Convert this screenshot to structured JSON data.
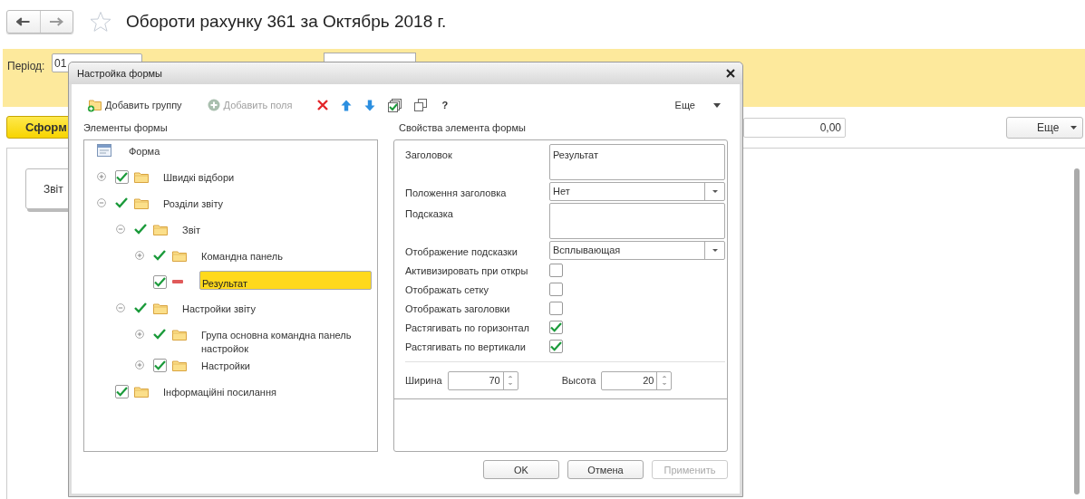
{
  "header": {
    "title": "Обороти рахунку 361 за Октябрь 2018 г."
  },
  "filter_bar": {
    "period_label": "Період:",
    "period_value": "01"
  },
  "command_bar": {
    "generate_button": "Сформ",
    "total_value": "0,00",
    "more_button": "Еще"
  },
  "report": {
    "tab_label": "Звіт"
  },
  "dialog": {
    "title": "Настройка формы",
    "toolbar": [
      {
        "kind": "add-group",
        "label": "Добавить группу",
        "disabled": false
      },
      {
        "kind": "add-field",
        "label": "Добавить поля",
        "disabled": true
      },
      {
        "kind": "delete",
        "disabled": false
      },
      {
        "kind": "up",
        "disabled": false
      },
      {
        "kind": "down",
        "disabled": false
      },
      {
        "kind": "check-all",
        "disabled": false
      },
      {
        "kind": "copy",
        "disabled": false
      },
      {
        "kind": "help",
        "label": "?",
        "disabled": false
      }
    ],
    "more_button": "Еще",
    "tree_heading": "Элементы формы",
    "properties_heading": "Свойства элемента формы",
    "tree": [
      {
        "label": "Форма",
        "kind": "form",
        "selected": false,
        "children": [
          {
            "label": "Швидкі відбори",
            "kind": "boxed-folder",
            "checked": true,
            "expanded": false,
            "selected": false
          },
          {
            "label": "Розділи звіту",
            "kind": "ticked-folder",
            "checked": true,
            "expanded": true,
            "selected": false,
            "children": [
              {
                "label": "Звіт",
                "kind": "ticked-folder",
                "checked": true,
                "expanded": true,
                "selected": false,
                "children": [
                  {
                    "label": "Командна панель",
                    "kind": "ticked-folder",
                    "checked": true,
                    "expanded": false,
                    "selected": false
                  },
                  {
                    "label": "Результат",
                    "kind": "boxed-field",
                    "checked": true,
                    "selected": true
                  }
                ]
              },
              {
                "label": "Настройки звіту",
                "kind": "ticked-folder",
                "checked": true,
                "expanded": true,
                "selected": false,
                "children": [
                  {
                    "label": "Група основна командна панель настройок",
                    "kind": "ticked-folder",
                    "checked": true,
                    "expanded": false,
                    "selected": false
                  },
                  {
                    "label": "Настройки",
                    "kind": "boxed-folder",
                    "checked": true,
                    "expanded": false,
                    "selected": false
                  }
                ]
              }
            ]
          },
          {
            "label": "Інформаційні посилання",
            "kind": "boxed-folder",
            "checked": true,
            "selected": false
          }
        ]
      }
    ],
    "properties": [
      {
        "kind": "textarea",
        "label": "Заголовок",
        "value": "Результат"
      },
      {
        "kind": "select",
        "label": "Положення заголовка",
        "value": "Нет"
      },
      {
        "kind": "textarea",
        "label": "Подсказка"
      },
      {
        "kind": "select",
        "label": "Отображение подсказки",
        "value": "Всплывающая"
      },
      {
        "kind": "checkbox",
        "label": "Активизировать при откры",
        "checked": false
      },
      {
        "kind": "checkbox",
        "label": "Отображать сетку",
        "checked": false
      },
      {
        "kind": "checkbox",
        "label": "Отображать заголовки",
        "checked": false
      },
      {
        "kind": "checkbox",
        "label": "Растягивать по горизонтал",
        "checked": true
      },
      {
        "kind": "checkbox",
        "label": "Растягивать по вертикали",
        "checked": true
      }
    ],
    "width": {
      "label": "Ширина",
      "value": "70"
    },
    "height": {
      "label": "Высота",
      "value": "20"
    },
    "buttons": [
      {
        "label": "OK",
        "disabled": false
      },
      {
        "label": "Отмена",
        "disabled": false
      },
      {
        "label": "Применить",
        "disabled": true
      }
    ]
  }
}
